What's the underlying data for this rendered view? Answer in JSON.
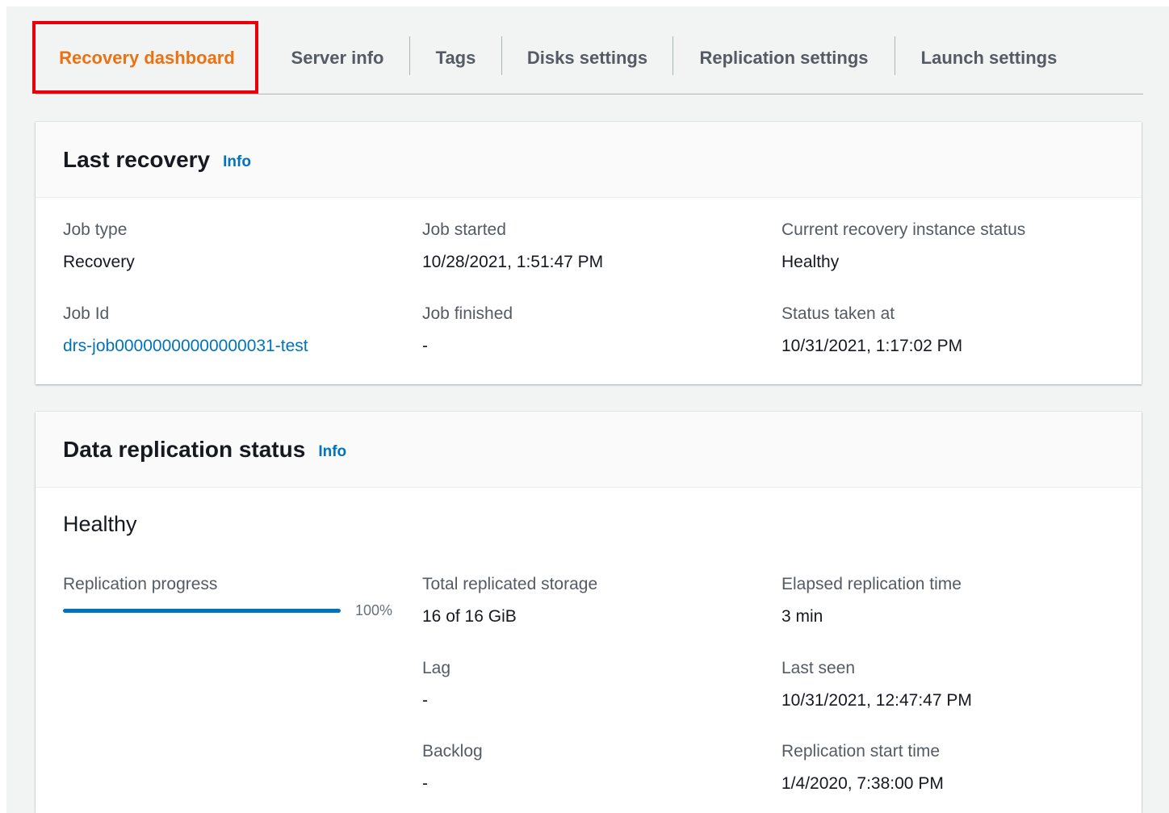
{
  "tabs": [
    {
      "label": "Recovery dashboard",
      "active": true
    },
    {
      "label": "Server info",
      "active": false
    },
    {
      "label": "Tags",
      "active": false
    },
    {
      "label": "Disks settings",
      "active": false
    },
    {
      "label": "Replication settings",
      "active": false
    },
    {
      "label": "Launch settings",
      "active": false
    }
  ],
  "last_recovery": {
    "title": "Last recovery",
    "info": "Info",
    "job_type": {
      "label": "Job type",
      "value": "Recovery"
    },
    "job_id": {
      "label": "Job Id",
      "value": "drs-job00000000000000031-test"
    },
    "job_started": {
      "label": "Job started",
      "value": "10/28/2021, 1:51:47 PM"
    },
    "job_finished": {
      "label": "Job finished",
      "value": "-"
    },
    "instance_status": {
      "label": "Current recovery instance status",
      "value": "Healthy"
    },
    "status_taken_at": {
      "label": "Status taken at",
      "value": "10/31/2021, 1:17:02 PM"
    }
  },
  "data_replication": {
    "title": "Data replication status",
    "info": "Info",
    "status": "Healthy",
    "progress": {
      "label": "Replication progress",
      "percent": 100,
      "percent_text": "100%"
    },
    "total_storage": {
      "label": "Total replicated storage",
      "value": "16 of 16 GiB"
    },
    "lag": {
      "label": "Lag",
      "value": "-"
    },
    "backlog": {
      "label": "Backlog",
      "value": "-"
    },
    "elapsed": {
      "label": "Elapsed replication time",
      "value": "3 min"
    },
    "last_seen": {
      "label": "Last seen",
      "value": "10/31/2021, 12:47:47 PM"
    },
    "start_time": {
      "label": "Replication start time",
      "value": "1/4/2020, 7:38:00 PM"
    }
  },
  "colors": {
    "accent": "#ec7211",
    "link": "#0073bb",
    "highlight": "#e8000b"
  }
}
